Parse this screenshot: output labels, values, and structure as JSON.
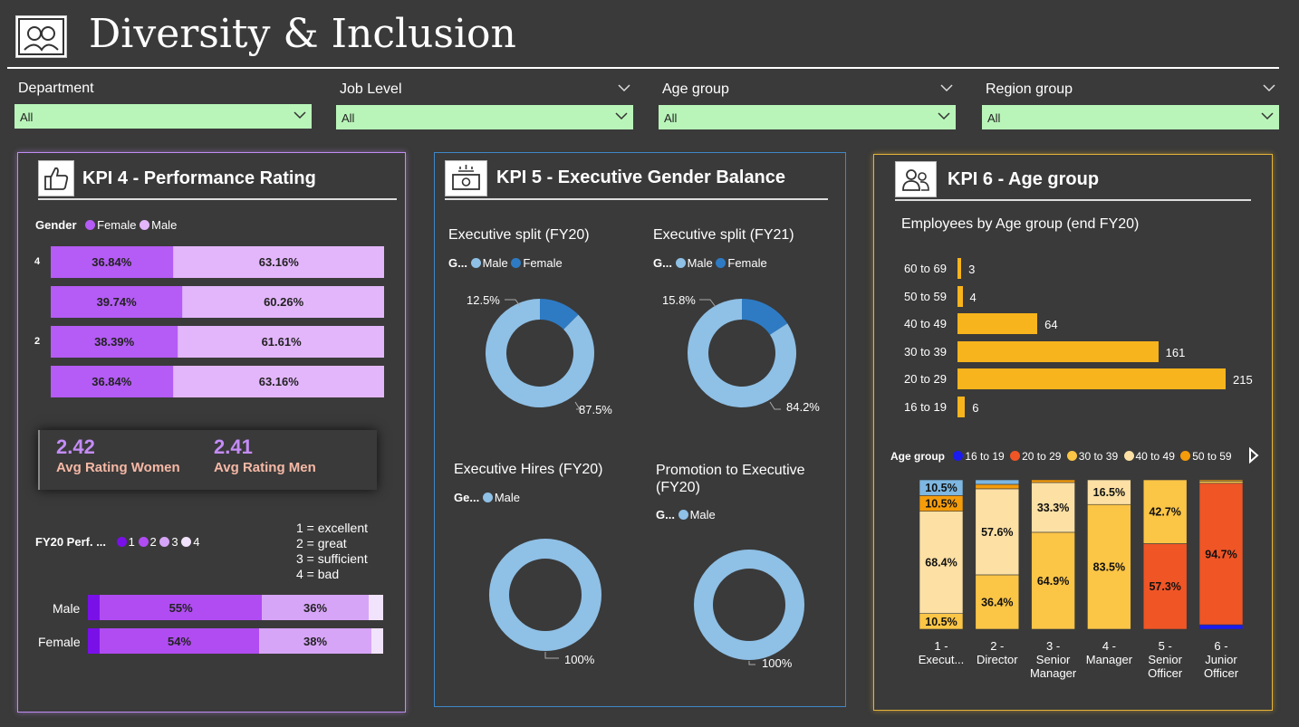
{
  "header": {
    "title": "Diversity & Inclusion",
    "logo_icon": "people-icon"
  },
  "filters": [
    {
      "label": "Department",
      "value": "All"
    },
    {
      "label": "Job Level",
      "value": "All"
    },
    {
      "label": "Age group",
      "value": "All"
    },
    {
      "label": "Region group",
      "value": "All"
    }
  ],
  "colors": {
    "female_purple": "#b45cf5",
    "male_lilac": "#e3b6fb",
    "exec_male": "#8fc0e6",
    "exec_female": "#2e7bc4",
    "age_bar": "#f8b41c",
    "filter_bg": "#b9f5b9",
    "kpi4_border": "#c18cf4",
    "kpi5_border": "#3f87c9",
    "kpi6_border": "#e5b437",
    "avg_value": "#c48cf7",
    "avg_label": "#f6b9a6"
  },
  "kpi4": {
    "title": "KPI 4 - Performance Rating",
    "icon": "thumbs-up-icon",
    "gender_legend": {
      "title": "Gender",
      "items": [
        "Female",
        "Male"
      ]
    },
    "avg_women": {
      "value": "2.42",
      "label": "Avg Rating Women"
    },
    "avg_men": {
      "value": "2.41",
      "label": "Avg Rating Men"
    },
    "perf_legend": {
      "title": "FY20 Perf. ...",
      "items": [
        "1",
        "2",
        "3",
        "4"
      ]
    },
    "scale_notes": [
      "1 = excellent",
      "2 = great",
      "3 = sufficient",
      "4 = bad"
    ]
  },
  "kpi5": {
    "title": "KPI 5 - Executive Gender Balance",
    "icon": "money-icon",
    "legend_male": "Male",
    "legend_female": "Female"
  },
  "kpi6": {
    "title": "KPI 6 - Age group",
    "icon": "user-group-icon",
    "bar_title": "Employees by Age group (end FY20)",
    "legend_title": "Age group"
  },
  "chart_data": [
    {
      "id": "rating_by_gender",
      "type": "bar",
      "orientation": "horizontal",
      "stacked": "100%",
      "categories": [
        "4",
        "",
        "2",
        ""
      ],
      "series": [
        {
          "name": "Female",
          "values": [
            36.84,
            39.74,
            38.39,
            36.84
          ],
          "labels": [
            "36.84%",
            "39.74%",
            "38.39%",
            "36.84%"
          ]
        },
        {
          "name": "Male",
          "values": [
            63.16,
            60.26,
            61.61,
            63.16
          ],
          "labels": [
            "63.16%",
            "60.26%",
            "61.61%",
            "63.16%"
          ]
        }
      ]
    },
    {
      "id": "perf_by_gender",
      "type": "bar",
      "orientation": "horizontal",
      "stacked": "100%",
      "categories": [
        "Male",
        "Female"
      ],
      "series": [
        {
          "name": "1",
          "color": "#7a10e8",
          "values": [
            4,
            4
          ]
        },
        {
          "name": "2",
          "color": "#b04cf2",
          "values": [
            55,
            54
          ],
          "labels": [
            "55%",
            "54%"
          ]
        },
        {
          "name": "3",
          "color": "#d7a5f8",
          "values": [
            36,
            38
          ],
          "labels": [
            "36%",
            "38%"
          ]
        },
        {
          "name": "4",
          "color": "#f1e3fc",
          "values": [
            5,
            4
          ]
        }
      ]
    },
    {
      "id": "exec_split_fy20",
      "type": "pie",
      "donut": true,
      "title": "Executive split (FY20)",
      "legend_title": "G...",
      "legend": [
        "Male",
        "Female"
      ],
      "slices": [
        {
          "name": "Male",
          "value": 87.5,
          "label": "87.5%"
        },
        {
          "name": "Female",
          "value": 12.5,
          "label": "12.5%"
        }
      ]
    },
    {
      "id": "exec_split_fy21",
      "type": "pie",
      "donut": true,
      "title": "Executive split (FY21)",
      "legend_title": "G...",
      "legend": [
        "Male",
        "Female"
      ],
      "slices": [
        {
          "name": "Male",
          "value": 84.2,
          "label": "84.2%"
        },
        {
          "name": "Female",
          "value": 15.8,
          "label": "15.8%"
        }
      ]
    },
    {
      "id": "exec_hires_fy20",
      "type": "pie",
      "donut": true,
      "title": "Executive Hires (FY20)",
      "legend_title": "Ge...",
      "legend": [
        "Male"
      ],
      "slices": [
        {
          "name": "Male",
          "value": 100,
          "label": "100%"
        }
      ]
    },
    {
      "id": "promo_exec_fy20",
      "type": "pie",
      "donut": true,
      "title": "Promotion to Executive (FY20)",
      "title_lines": [
        "Promotion to Executive",
        "(FY20)"
      ],
      "legend_title": "G...",
      "legend": [
        "Male"
      ],
      "slices": [
        {
          "name": "Male",
          "value": 100,
          "label": "100%"
        }
      ]
    },
    {
      "id": "employees_by_age",
      "type": "bar",
      "orientation": "horizontal",
      "title": "Employees by Age group (end FY20)",
      "categories": [
        "60 to 69",
        "50 to 59",
        "40 to 49",
        "30 to 39",
        "20 to 29",
        "16 to 19"
      ],
      "values": [
        3,
        4,
        64,
        161,
        215,
        6
      ],
      "xlim": [
        0,
        215
      ]
    },
    {
      "id": "age_by_job_level",
      "type": "bar",
      "orientation": "vertical",
      "stacked": "100%",
      "legend_title": "Age group",
      "categories": [
        [
          "1 -",
          "Execut..."
        ],
        [
          "2 -",
          "Director"
        ],
        [
          "3 -",
          "Senior",
          "Manager"
        ],
        [
          "4 -",
          "Manager"
        ],
        [
          "5 -",
          "Senior",
          "Officer"
        ],
        [
          "6 -",
          "Junior",
          "Officer"
        ]
      ],
      "series": [
        {
          "name": "16 to 19",
          "color": "#1b1bf0",
          "values": [
            0,
            0,
            0,
            0,
            0,
            3.0
          ],
          "labels": [
            "",
            "",
            "",
            "",
            "",
            ""
          ]
        },
        {
          "name": "20 to 29",
          "color": "#f05526",
          "values": [
            0,
            0,
            0,
            0,
            57.3,
            94.7
          ],
          "labels": [
            "",
            "",
            "",
            "",
            "57.3%",
            "94.7%"
          ]
        },
        {
          "name": "30 to 39",
          "color": "#fbc546",
          "values": [
            10.5,
            36.4,
            64.9,
            83.5,
            42.7,
            1.5
          ],
          "labels": [
            "10.5%",
            "36.4%",
            "64.9%",
            "83.5%",
            "42.7%",
            ""
          ]
        },
        {
          "name": "40 to 49",
          "color": "#fce0a4",
          "values": [
            68.4,
            57.6,
            33.3,
            16.5,
            0,
            0
          ],
          "labels": [
            "68.4%",
            "57.6%",
            "33.3%",
            "16.5%",
            "",
            ""
          ]
        },
        {
          "name": "50 to 59",
          "color": "#f59c0b",
          "values": [
            10.5,
            3.0,
            1.8,
            0,
            0,
            0.8
          ],
          "labels": [
            "10.5%",
            "",
            "",
            "",
            "",
            ""
          ]
        },
        {
          "name": "60 to 69",
          "color": "#7db7e2",
          "values": [
            10.5,
            3.0,
            0,
            0,
            0,
            0
          ],
          "labels": [
            "10.5%",
            "",
            "",
            "",
            "",
            ""
          ]
        }
      ],
      "legend": [
        "16 to 19",
        "20 to 29",
        "30 to 39",
        "40 to 49",
        "50 to 59"
      ]
    }
  ]
}
